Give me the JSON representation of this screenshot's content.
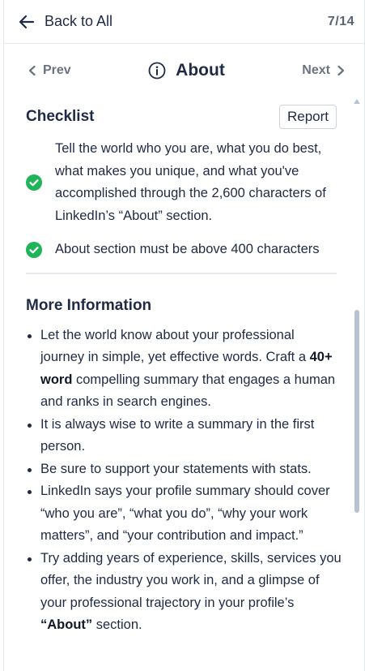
{
  "topbar": {
    "back_label": "Back to All",
    "counter": "7/14"
  },
  "nav": {
    "prev_label": "Prev",
    "next_label": "Next",
    "section_title": "About"
  },
  "checklist": {
    "title": "Checklist",
    "report_label": "Report",
    "items": [
      "Tell the world who you are, what you do best, what makes you unique, and what you've accomplished through the 2,600 characters of LinkedIn’s “About” section.",
      "About section must be above 400 characters"
    ]
  },
  "more_info": {
    "title": "More Information",
    "items": [
      {
        "pre": "Let the world know about your professional journey in simple, yet effective words. Craft a ",
        "bold": "40+ word",
        "post": " compelling summary that engages a human and ranks in search engines."
      },
      {
        "pre": "It is always wise to write a summary in the first person.",
        "bold": "",
        "post": ""
      },
      {
        "pre": "Be sure to support your statements with stats.",
        "bold": "",
        "post": ""
      },
      {
        "pre": "LinkedIn says your profile summary should cover “who you are”, “what you do”, “why your work matters”, and “your contribution and impact.”",
        "bold": "",
        "post": ""
      },
      {
        "pre": "Try adding years of experience, skills, services you offer, the industry you work in, and a glimpse of your professional trajectory in your profile’s ",
        "bold": "“About”",
        "post": " section."
      }
    ]
  },
  "colors": {
    "check_green": "#1fb35a",
    "text": "#1f2a44",
    "muted": "#6b7280"
  }
}
